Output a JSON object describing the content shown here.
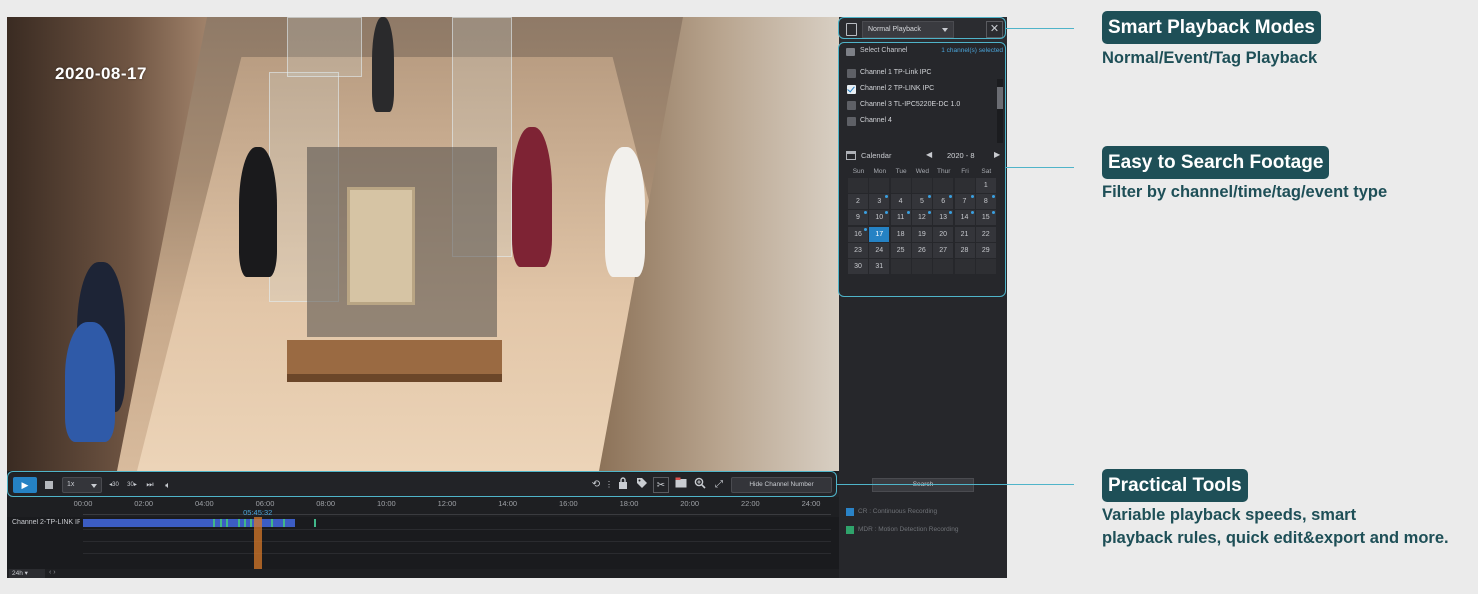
{
  "video": {
    "date_stamp": "2020-08-17"
  },
  "side_panel": {
    "mode_select": "Normal Playback",
    "close_icon": "close-icon",
    "channels_header": "Select Channel",
    "channels_selected": "1 channel(s) selected",
    "channels": [
      {
        "label": "Channel 1 TP-Link IPC",
        "checked": false
      },
      {
        "label": "Channel 2 TP-LINK IPC",
        "checked": true
      },
      {
        "label": "Channel 3 TL-IPC5220E-DC 1.0",
        "checked": false
      },
      {
        "label": "Channel 4",
        "checked": false
      }
    ],
    "calendar": {
      "label": "Calendar",
      "month": "2020 - 8",
      "prev_icon": "caret-left-icon",
      "next_icon": "caret-right-icon",
      "weekdays": [
        "Sun",
        "Mon",
        "Tue",
        "Wed",
        "Thur",
        "Fri",
        "Sat"
      ],
      "first_weekday_index": 6,
      "days_in_month": 31,
      "selected_day": 17,
      "days_with_recordings": [
        3,
        5,
        6,
        7,
        8,
        9,
        10,
        11,
        12,
        13,
        14,
        15,
        16,
        17
      ]
    },
    "search_label": "Search",
    "recording_types": [
      {
        "label": "CR : Continuous Recording",
        "color": "#2a83c7"
      },
      {
        "label": "MDR : Motion Detection Recording",
        "color": "#2fa36b"
      }
    ]
  },
  "controls": {
    "speed": "1x",
    "back30": "◂30",
    "fwd30": "30▸",
    "hide_channel_label": "Hide Channel Number",
    "tools": [
      "replay-icon",
      "lock-icon",
      "tag-icon",
      "scissors-icon",
      "export-icon",
      "zoom-icon",
      "fullscreen-icon"
    ]
  },
  "timeline": {
    "ticks": [
      "00:00",
      "02:00",
      "04:00",
      "06:00",
      "08:00",
      "10:00",
      "12:00",
      "14:00",
      "16:00",
      "18:00",
      "20:00",
      "22:00",
      "24:00"
    ],
    "cursor_time": "05:45:32",
    "cursor_hours": 5.76,
    "track_label": "Channel 2-TP-LINK IPC",
    "recording_start_hours": 0,
    "recording_end_hours": 7.0,
    "motion_hours": [
      4.3,
      4.5,
      4.7,
      5.1,
      5.3,
      5.5,
      6.2,
      6.6,
      7.6
    ],
    "scale": "24h"
  },
  "callouts": [
    {
      "title": "Smart Playback Modes",
      "desc": [
        "Normal/Event/Tag Playback"
      ]
    },
    {
      "title": "Easy to Search Footage",
      "desc": [
        "Filter by channel/time/tag/event type"
      ]
    },
    {
      "title": "Practical Tools",
      "desc": [
        "Variable playback speeds, smart",
        "playback rules, quick edit&export and more."
      ]
    }
  ],
  "colors": {
    "accent": "#2582c4",
    "callout_bg": "#1e4f57",
    "highlight": "#4fb4c9"
  }
}
